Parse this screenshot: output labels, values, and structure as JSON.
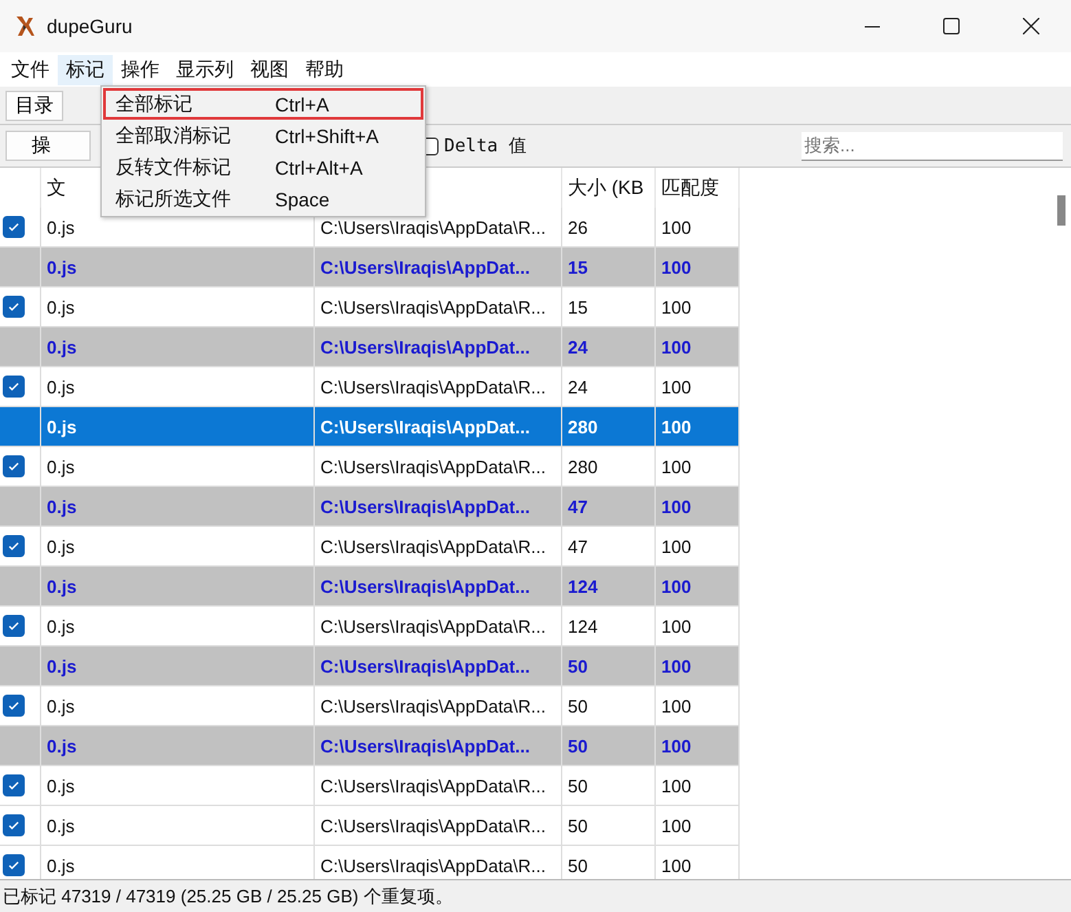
{
  "window": {
    "title": "dupeGuru"
  },
  "menubar": [
    {
      "label": "文件",
      "selected": false
    },
    {
      "label": "标记",
      "selected": true
    },
    {
      "label": "操作",
      "selected": false
    },
    {
      "label": "显示列",
      "selected": false
    },
    {
      "label": "视图",
      "selected": false
    },
    {
      "label": "帮助",
      "selected": false
    }
  ],
  "toolbar": {
    "button": "目录"
  },
  "actions": {
    "button": "操",
    "delta": {
      "label": "Delta 值",
      "checked": false
    },
    "search": {
      "placeholder": "搜索..."
    }
  },
  "dropdown": [
    {
      "label": "全部标记",
      "shortcut": "Ctrl+A",
      "highlighted": true
    },
    {
      "label": "全部取消标记",
      "shortcut": "Ctrl+Shift+A",
      "highlighted": false
    },
    {
      "label": "反转文件标记",
      "shortcut": "Ctrl+Alt+A",
      "highlighted": false
    },
    {
      "label": "标记所选文件",
      "shortcut": "Space",
      "highlighted": false
    }
  ],
  "table": {
    "columns": [
      "文",
      "",
      "大小 (KB",
      "匹配度"
    ],
    "rows": [
      {
        "kind": "duplicate",
        "checked": true,
        "selected": false,
        "cells": [
          "0.js",
          "C:\\Users\\Iraqis\\AppData\\R...",
          "26",
          "100"
        ]
      },
      {
        "kind": "reference",
        "selected": false,
        "cells": [
          "0.js",
          "C:\\Users\\Iraqis\\AppDat...",
          "15",
          "100"
        ]
      },
      {
        "kind": "duplicate",
        "checked": true,
        "selected": false,
        "cells": [
          "0.js",
          "C:\\Users\\Iraqis\\AppData\\R...",
          "15",
          "100"
        ]
      },
      {
        "kind": "reference",
        "selected": false,
        "cells": [
          "0.js",
          "C:\\Users\\Iraqis\\AppDat...",
          "24",
          "100"
        ]
      },
      {
        "kind": "duplicate",
        "checked": true,
        "selected": false,
        "cells": [
          "0.js",
          "C:\\Users\\Iraqis\\AppData\\R...",
          "24",
          "100"
        ]
      },
      {
        "kind": "reference",
        "selected": true,
        "cells": [
          "0.js",
          "C:\\Users\\Iraqis\\AppDat...",
          "280",
          "100"
        ]
      },
      {
        "kind": "duplicate",
        "checked": true,
        "selected": false,
        "cells": [
          "0.js",
          "C:\\Users\\Iraqis\\AppData\\R...",
          "280",
          "100"
        ]
      },
      {
        "kind": "reference",
        "selected": false,
        "cells": [
          "0.js",
          "C:\\Users\\Iraqis\\AppDat...",
          "47",
          "100"
        ]
      },
      {
        "kind": "duplicate",
        "checked": true,
        "selected": false,
        "cells": [
          "0.js",
          "C:\\Users\\Iraqis\\AppData\\R...",
          "47",
          "100"
        ]
      },
      {
        "kind": "reference",
        "selected": false,
        "cells": [
          "0.js",
          "C:\\Users\\Iraqis\\AppDat...",
          "124",
          "100"
        ]
      },
      {
        "kind": "duplicate",
        "checked": true,
        "selected": false,
        "cells": [
          "0.js",
          "C:\\Users\\Iraqis\\AppData\\R...",
          "124",
          "100"
        ]
      },
      {
        "kind": "reference",
        "selected": false,
        "cells": [
          "0.js",
          "C:\\Users\\Iraqis\\AppDat...",
          "50",
          "100"
        ]
      },
      {
        "kind": "duplicate",
        "checked": true,
        "selected": false,
        "cells": [
          "0.js",
          "C:\\Users\\Iraqis\\AppData\\R...",
          "50",
          "100"
        ]
      },
      {
        "kind": "reference",
        "selected": false,
        "cells": [
          "0.js",
          "C:\\Users\\Iraqis\\AppDat...",
          "50",
          "100"
        ]
      },
      {
        "kind": "duplicate",
        "checked": true,
        "selected": false,
        "cells": [
          "0.js",
          "C:\\Users\\Iraqis\\AppData\\R...",
          "50",
          "100"
        ]
      },
      {
        "kind": "duplicate",
        "checked": true,
        "selected": false,
        "cells": [
          "0.js",
          "C:\\Users\\Iraqis\\AppData\\R...",
          "50",
          "100"
        ]
      },
      {
        "kind": "duplicate",
        "checked": true,
        "selected": false,
        "cells": [
          "0.js",
          "C:\\Users\\Iraqis\\AppData\\R...",
          "50",
          "100"
        ]
      }
    ]
  },
  "status_bar": "已标记 47319 / 47319 (25.25 GB / 25.25 GB) 个重复项。"
}
